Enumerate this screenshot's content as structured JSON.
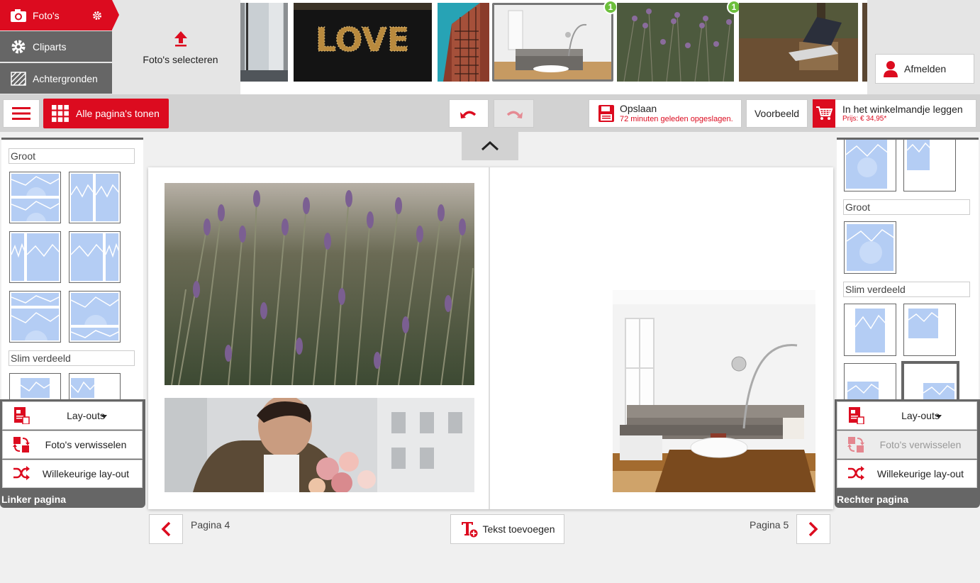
{
  "tabs": [
    {
      "label": "Foto's",
      "icon": "camera-icon",
      "active": true
    },
    {
      "label": "Cliparts",
      "icon": "gear-icon",
      "active": false
    },
    {
      "label": "Achtergronden",
      "icon": "background-pattern-icon",
      "active": false
    }
  ],
  "select_photos_label": "Foto's selecteren",
  "thumbnails": [
    {
      "name": "window-photo",
      "badge": ""
    },
    {
      "name": "love-sign-photo",
      "badge": ""
    },
    {
      "name": "building-photo",
      "badge": ""
    },
    {
      "name": "living-room-photo",
      "badge": "1"
    },
    {
      "name": "lavender-photo",
      "badge": "1"
    },
    {
      "name": "laptop-forest-photo",
      "badge": ""
    }
  ],
  "logout_label": "Afmelden",
  "toolbar": {
    "all_pages_label": "Alle pagina's tonen",
    "save_label": "Opslaan",
    "save_status": "72 minuten geleden opgeslagen.",
    "preview_label": "Voorbeeld",
    "cart_label": "In het winkelmandje leggen",
    "price_label": "Prijs: € 34,95*"
  },
  "left_panel": {
    "section_large": "Groot",
    "section_smart": "Slim verdeeld",
    "layouts_label": "Lay-outs",
    "swap_label": "Foto's verwisselen",
    "random_label": "Willekeurige lay-out",
    "title": "Linker pagina"
  },
  "right_panel": {
    "section_large": "Groot",
    "section_smart": "Slim verdeeld",
    "layouts_label": "Lay-outs",
    "swap_label": "Foto's verwisselen",
    "random_label": "Willekeurige lay-out",
    "title": "Rechter pagina"
  },
  "bottom": {
    "page_left": "Pagina 4",
    "page_right": "Pagina 5",
    "add_text_label": "Tekst toevoegen"
  },
  "colors": {
    "accent": "#dc0b1f",
    "badge": "#6cbf3b",
    "placeholder": "#b4cdf4"
  }
}
